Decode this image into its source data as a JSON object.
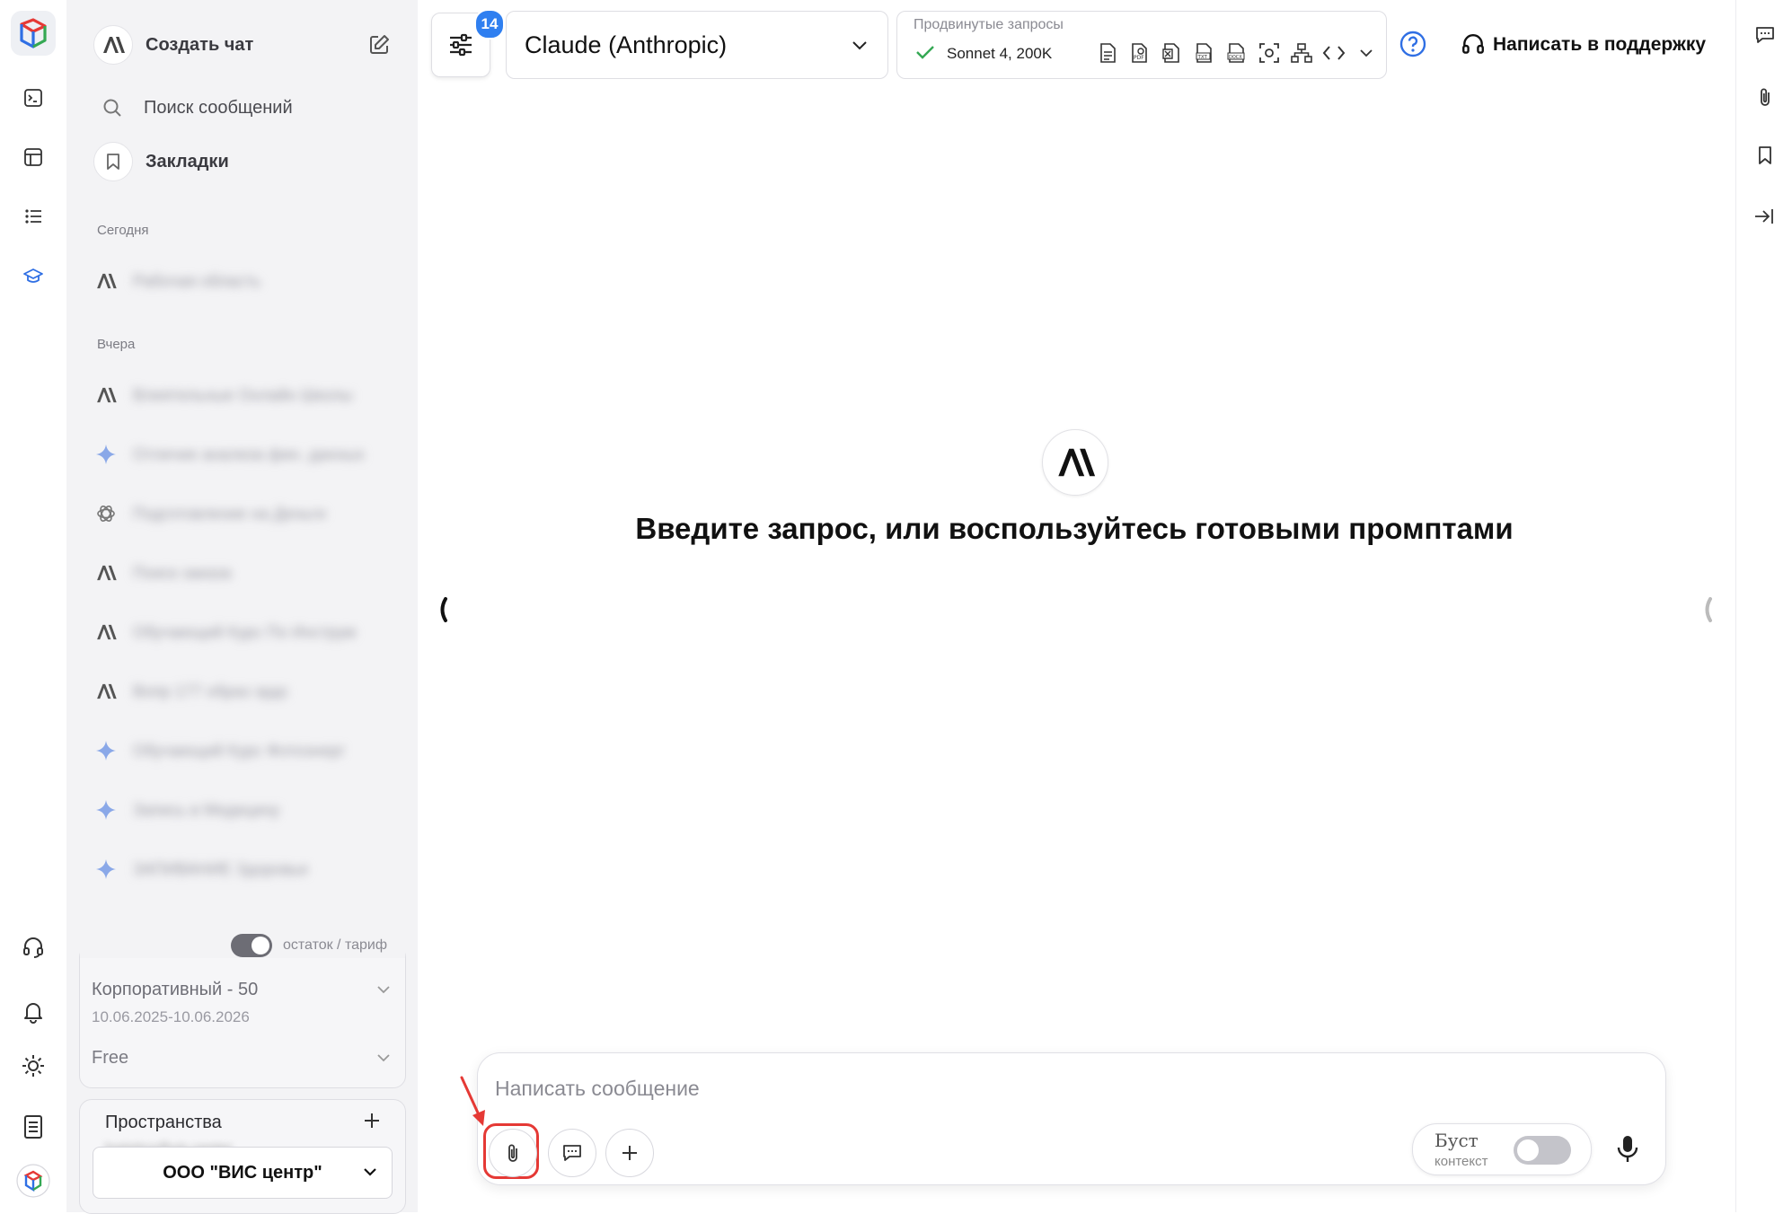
{
  "sidebar": {
    "create_chat": "Создать чат",
    "search_placeholder": "Поиск сообщений",
    "bookmarks": "Закладки",
    "sections": [
      {
        "label": "Сегодня",
        "items": [
          {
            "icon": "anthropic-icon",
            "text": "Рабочая область"
          }
        ]
      },
      {
        "label": "Вчера",
        "items": [
          {
            "icon": "anthropic-icon",
            "text": "Влиятельные Онлайн Школы"
          },
          {
            "icon": "gemini-sparkle-icon",
            "text": "Отличие анализа фин. данных"
          },
          {
            "icon": "openai-icon",
            "text": "Подготовление на Деньги"
          },
          {
            "icon": "anthropic-icon",
            "text": "Поиск заказа"
          },
          {
            "icon": "anthropic-icon",
            "text": "Обучающий Курс По Инструм"
          },
          {
            "icon": "anthropic-icon",
            "text": "Вопр 177 образ эрдс"
          },
          {
            "icon": "gemini-sparkle-icon",
            "text": "Обучающий Курс Фотоэнерг"
          },
          {
            "icon": "gemini-sparkle-icon",
            "text": "Запись в Медицину"
          },
          {
            "icon": "gemini-sparkle-icon",
            "text": "ЗАПИВАНИЕ Здоровье"
          }
        ]
      }
    ],
    "balance_toggle_label": "остаток / тариф",
    "plan": {
      "name": "Корпоративный - 50",
      "dates": "10.06.2025-10.06.2026",
      "free": "Free"
    },
    "spaces": {
      "title": "Пространства",
      "email": "logistics@vis.center",
      "org": "ООО \"ВИС центр\""
    }
  },
  "topbar": {
    "settings_badge": "14",
    "model": "Claude (Anthropic)",
    "advanced_title": "Продвинутые запросы",
    "advanced_value": "Sonnet 4, 200K",
    "support": "Написать в поддержку"
  },
  "main": {
    "headline": "Введите запрос, или воспользуйтесь готовыми промптами"
  },
  "composer": {
    "placeholder": "Написать сообщение",
    "boost_label": "Буст",
    "boost_sub": "контекст"
  },
  "colors": {
    "accent_blue": "#2f6fe4",
    "badge": "#2f7ff0",
    "check_green": "#34a853",
    "annotation_red": "#e53935"
  }
}
